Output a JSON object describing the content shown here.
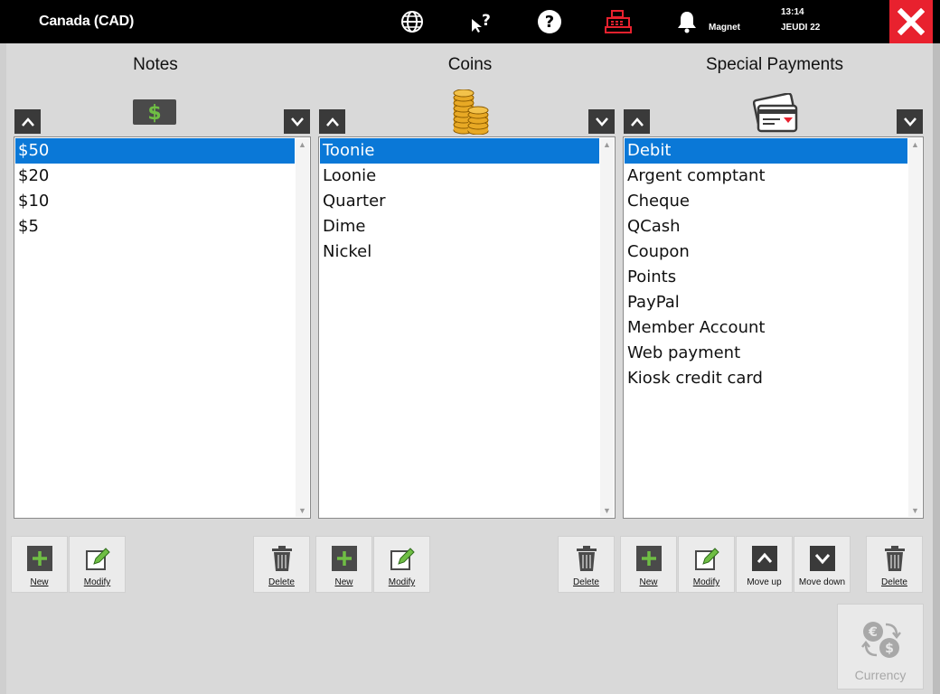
{
  "header": {
    "title": "Canada (CAD)",
    "user": "Magnet",
    "time": "13:14",
    "day": "JEUDI 22",
    "icons": [
      "globe-icon",
      "cursor-help-icon",
      "help-icon",
      "cash-register-icon",
      "bell-icon",
      "close-icon"
    ]
  },
  "columns": {
    "notes": {
      "title": "Notes",
      "items": [
        "$50",
        "$20",
        "$10",
        "$5"
      ],
      "selected": 0
    },
    "coins": {
      "title": "Coins",
      "items": [
        "Toonie",
        "Loonie",
        "Quarter",
        "Dime",
        "Nickel"
      ],
      "selected": 0
    },
    "special": {
      "title": "Special Payments",
      "items": [
        "Debit",
        "Argent comptant",
        "Cheque",
        "QCash",
        "Coupon",
        "Points",
        "PayPal",
        "Member Account",
        "Web payment",
        "Kiosk credit card"
      ],
      "selected": 0
    }
  },
  "actions": {
    "new": "New",
    "modify": "Modify",
    "delete": "Delete",
    "move_up": "Move up",
    "move_down": "Move down",
    "currency": "Currency"
  },
  "colors": {
    "accent_red": "#e8212e",
    "selection_blue": "#0a78d7",
    "green": "#6fbe44",
    "coin_gold": "#e8a925"
  }
}
